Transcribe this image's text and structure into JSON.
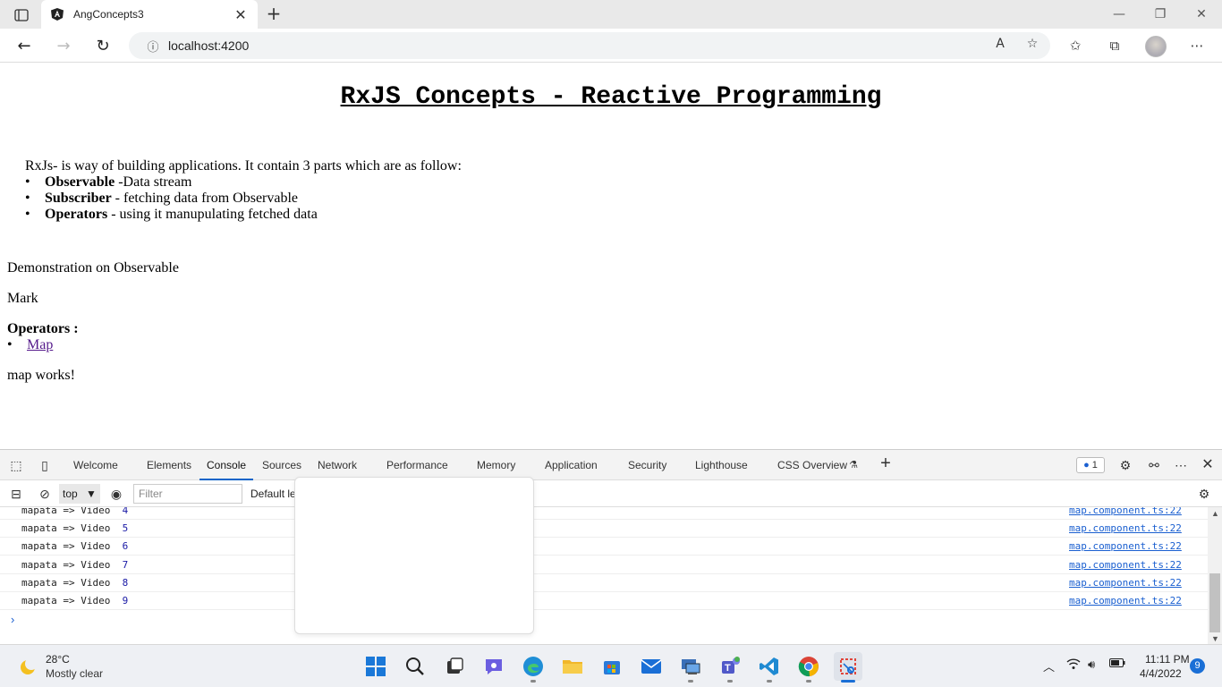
{
  "browser": {
    "tab_title": "AngConcepts3",
    "url": "localhost:4200"
  },
  "page": {
    "heading": "RxJS Concepts - Reactive Programming",
    "intro": "RxJs- is way of building applications. It contain 3 parts which are as follow:",
    "parts": [
      {
        "term": "Observable",
        "desc": " -Data stream"
      },
      {
        "term": "Subscriber",
        "desc": " - fetching data from Observable"
      },
      {
        "term": "Operators",
        "desc": " - using it manupulating fetched data"
      }
    ],
    "demo_text": "Demonstration on Observable",
    "mark_text": "Mark",
    "operators_label": "Operators :",
    "operator_links": [
      "Map"
    ],
    "map_works": "map works!"
  },
  "devtools": {
    "tabs": [
      "Welcome",
      "Elements",
      "Console",
      "Sources",
      "Network",
      "Performance",
      "Memory",
      "Application",
      "Security",
      "Lighthouse",
      "CSS Overview"
    ],
    "active_tab": "Console",
    "issues_count": "1",
    "context": "top",
    "filter_placeholder": "Filter",
    "levels_label": "Default levels",
    "message_count": "1",
    "logs": [
      {
        "text": "mapata => Video",
        "num": "4",
        "source": "map.component.ts:22"
      },
      {
        "text": "mapata => Video",
        "num": "5",
        "source": "map.component.ts:22"
      },
      {
        "text": "mapata => Video",
        "num": "6",
        "source": "map.component.ts:22"
      },
      {
        "text": "mapata => Video",
        "num": "7",
        "source": "map.component.ts:22"
      },
      {
        "text": "mapata => Video",
        "num": "8",
        "source": "map.component.ts:22"
      },
      {
        "text": "mapata => Video",
        "num": "9",
        "source": "map.component.ts:22"
      }
    ],
    "prompt": "›"
  },
  "taskbar": {
    "temperature": "28°C",
    "weather": "Mostly clear",
    "time": "11:11 PM",
    "date": "4/4/2022",
    "notifications": "9",
    "apps": [
      "start-icon",
      "search-icon",
      "task-view-icon",
      "chat-icon",
      "edge-icon",
      "file-explorer-icon",
      "store-icon",
      "mail-icon",
      "remote-desktop-icon",
      "teams-icon",
      "vscode-icon",
      "chrome-icon",
      "snipping-tool-icon"
    ]
  },
  "colors": {
    "link_visited": "#551a8b",
    "accent_blue": "#1a5fd0",
    "taskbar_bg": "#eef0f4"
  }
}
